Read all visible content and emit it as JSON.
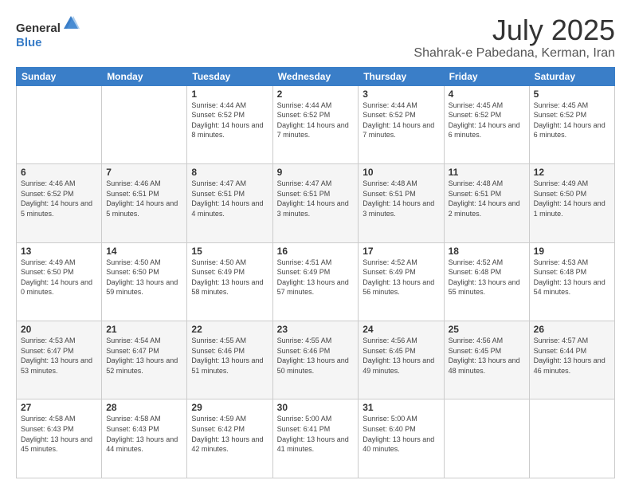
{
  "logo": {
    "general": "General",
    "blue": "Blue"
  },
  "title": "July 2025",
  "location": "Shahrak-e Pabedana, Kerman, Iran",
  "weekdays": [
    "Sunday",
    "Monday",
    "Tuesday",
    "Wednesday",
    "Thursday",
    "Friday",
    "Saturday"
  ],
  "weeks": [
    [
      {
        "day": "",
        "sunrise": "",
        "sunset": "",
        "daylight": ""
      },
      {
        "day": "",
        "sunrise": "",
        "sunset": "",
        "daylight": ""
      },
      {
        "day": "1",
        "sunrise": "Sunrise: 4:44 AM",
        "sunset": "Sunset: 6:52 PM",
        "daylight": "Daylight: 14 hours and 8 minutes."
      },
      {
        "day": "2",
        "sunrise": "Sunrise: 4:44 AM",
        "sunset": "Sunset: 6:52 PM",
        "daylight": "Daylight: 14 hours and 7 minutes."
      },
      {
        "day": "3",
        "sunrise": "Sunrise: 4:44 AM",
        "sunset": "Sunset: 6:52 PM",
        "daylight": "Daylight: 14 hours and 7 minutes."
      },
      {
        "day": "4",
        "sunrise": "Sunrise: 4:45 AM",
        "sunset": "Sunset: 6:52 PM",
        "daylight": "Daylight: 14 hours and 6 minutes."
      },
      {
        "day": "5",
        "sunrise": "Sunrise: 4:45 AM",
        "sunset": "Sunset: 6:52 PM",
        "daylight": "Daylight: 14 hours and 6 minutes."
      }
    ],
    [
      {
        "day": "6",
        "sunrise": "Sunrise: 4:46 AM",
        "sunset": "Sunset: 6:52 PM",
        "daylight": "Daylight: 14 hours and 5 minutes."
      },
      {
        "day": "7",
        "sunrise": "Sunrise: 4:46 AM",
        "sunset": "Sunset: 6:51 PM",
        "daylight": "Daylight: 14 hours and 5 minutes."
      },
      {
        "day": "8",
        "sunrise": "Sunrise: 4:47 AM",
        "sunset": "Sunset: 6:51 PM",
        "daylight": "Daylight: 14 hours and 4 minutes."
      },
      {
        "day": "9",
        "sunrise": "Sunrise: 4:47 AM",
        "sunset": "Sunset: 6:51 PM",
        "daylight": "Daylight: 14 hours and 3 minutes."
      },
      {
        "day": "10",
        "sunrise": "Sunrise: 4:48 AM",
        "sunset": "Sunset: 6:51 PM",
        "daylight": "Daylight: 14 hours and 3 minutes."
      },
      {
        "day": "11",
        "sunrise": "Sunrise: 4:48 AM",
        "sunset": "Sunset: 6:51 PM",
        "daylight": "Daylight: 14 hours and 2 minutes."
      },
      {
        "day": "12",
        "sunrise": "Sunrise: 4:49 AM",
        "sunset": "Sunset: 6:50 PM",
        "daylight": "Daylight: 14 hours and 1 minute."
      }
    ],
    [
      {
        "day": "13",
        "sunrise": "Sunrise: 4:49 AM",
        "sunset": "Sunset: 6:50 PM",
        "daylight": "Daylight: 14 hours and 0 minutes."
      },
      {
        "day": "14",
        "sunrise": "Sunrise: 4:50 AM",
        "sunset": "Sunset: 6:50 PM",
        "daylight": "Daylight: 13 hours and 59 minutes."
      },
      {
        "day": "15",
        "sunrise": "Sunrise: 4:50 AM",
        "sunset": "Sunset: 6:49 PM",
        "daylight": "Daylight: 13 hours and 58 minutes."
      },
      {
        "day": "16",
        "sunrise": "Sunrise: 4:51 AM",
        "sunset": "Sunset: 6:49 PM",
        "daylight": "Daylight: 13 hours and 57 minutes."
      },
      {
        "day": "17",
        "sunrise": "Sunrise: 4:52 AM",
        "sunset": "Sunset: 6:49 PM",
        "daylight": "Daylight: 13 hours and 56 minutes."
      },
      {
        "day": "18",
        "sunrise": "Sunrise: 4:52 AM",
        "sunset": "Sunset: 6:48 PM",
        "daylight": "Daylight: 13 hours and 55 minutes."
      },
      {
        "day": "19",
        "sunrise": "Sunrise: 4:53 AM",
        "sunset": "Sunset: 6:48 PM",
        "daylight": "Daylight: 13 hours and 54 minutes."
      }
    ],
    [
      {
        "day": "20",
        "sunrise": "Sunrise: 4:53 AM",
        "sunset": "Sunset: 6:47 PM",
        "daylight": "Daylight: 13 hours and 53 minutes."
      },
      {
        "day": "21",
        "sunrise": "Sunrise: 4:54 AM",
        "sunset": "Sunset: 6:47 PM",
        "daylight": "Daylight: 13 hours and 52 minutes."
      },
      {
        "day": "22",
        "sunrise": "Sunrise: 4:55 AM",
        "sunset": "Sunset: 6:46 PM",
        "daylight": "Daylight: 13 hours and 51 minutes."
      },
      {
        "day": "23",
        "sunrise": "Sunrise: 4:55 AM",
        "sunset": "Sunset: 6:46 PM",
        "daylight": "Daylight: 13 hours and 50 minutes."
      },
      {
        "day": "24",
        "sunrise": "Sunrise: 4:56 AM",
        "sunset": "Sunset: 6:45 PM",
        "daylight": "Daylight: 13 hours and 49 minutes."
      },
      {
        "day": "25",
        "sunrise": "Sunrise: 4:56 AM",
        "sunset": "Sunset: 6:45 PM",
        "daylight": "Daylight: 13 hours and 48 minutes."
      },
      {
        "day": "26",
        "sunrise": "Sunrise: 4:57 AM",
        "sunset": "Sunset: 6:44 PM",
        "daylight": "Daylight: 13 hours and 46 minutes."
      }
    ],
    [
      {
        "day": "27",
        "sunrise": "Sunrise: 4:58 AM",
        "sunset": "Sunset: 6:43 PM",
        "daylight": "Daylight: 13 hours and 45 minutes."
      },
      {
        "day": "28",
        "sunrise": "Sunrise: 4:58 AM",
        "sunset": "Sunset: 6:43 PM",
        "daylight": "Daylight: 13 hours and 44 minutes."
      },
      {
        "day": "29",
        "sunrise": "Sunrise: 4:59 AM",
        "sunset": "Sunset: 6:42 PM",
        "daylight": "Daylight: 13 hours and 42 minutes."
      },
      {
        "day": "30",
        "sunrise": "Sunrise: 5:00 AM",
        "sunset": "Sunset: 6:41 PM",
        "daylight": "Daylight: 13 hours and 41 minutes."
      },
      {
        "day": "31",
        "sunrise": "Sunrise: 5:00 AM",
        "sunset": "Sunset: 6:40 PM",
        "daylight": "Daylight: 13 hours and 40 minutes."
      },
      {
        "day": "",
        "sunrise": "",
        "sunset": "",
        "daylight": ""
      },
      {
        "day": "",
        "sunrise": "",
        "sunset": "",
        "daylight": ""
      }
    ]
  ]
}
